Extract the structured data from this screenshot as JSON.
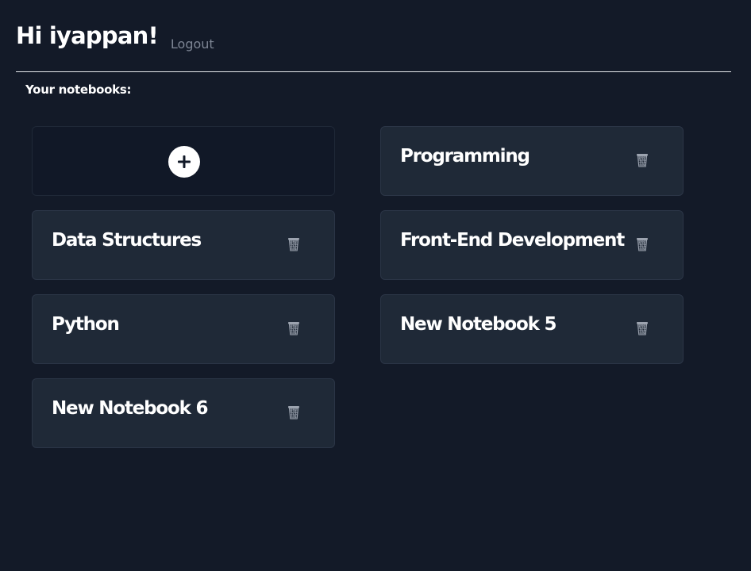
{
  "header": {
    "greeting": "Hi iyappan!",
    "logout_label": "Logout"
  },
  "section": {
    "label": "Your notebooks:"
  },
  "add_card": {
    "icon": "plus-circle-icon"
  },
  "notebooks": [
    {
      "title": "Programming",
      "delete_icon": "trash-icon"
    },
    {
      "title": "Data Structures",
      "delete_icon": "trash-icon"
    },
    {
      "title": "Front-End Development",
      "delete_icon": "trash-icon"
    },
    {
      "title": "Python",
      "delete_icon": "trash-icon"
    },
    {
      "title": "New Notebook 5",
      "delete_icon": "trash-icon"
    },
    {
      "title": "New Notebook 6",
      "delete_icon": "trash-icon"
    }
  ],
  "colors": {
    "background": "#131a28",
    "card_background": "#1f2937",
    "add_card_background": "#111827",
    "card_border": "#2b3546",
    "text": "#ffffff",
    "muted_text": "#7d8594"
  }
}
